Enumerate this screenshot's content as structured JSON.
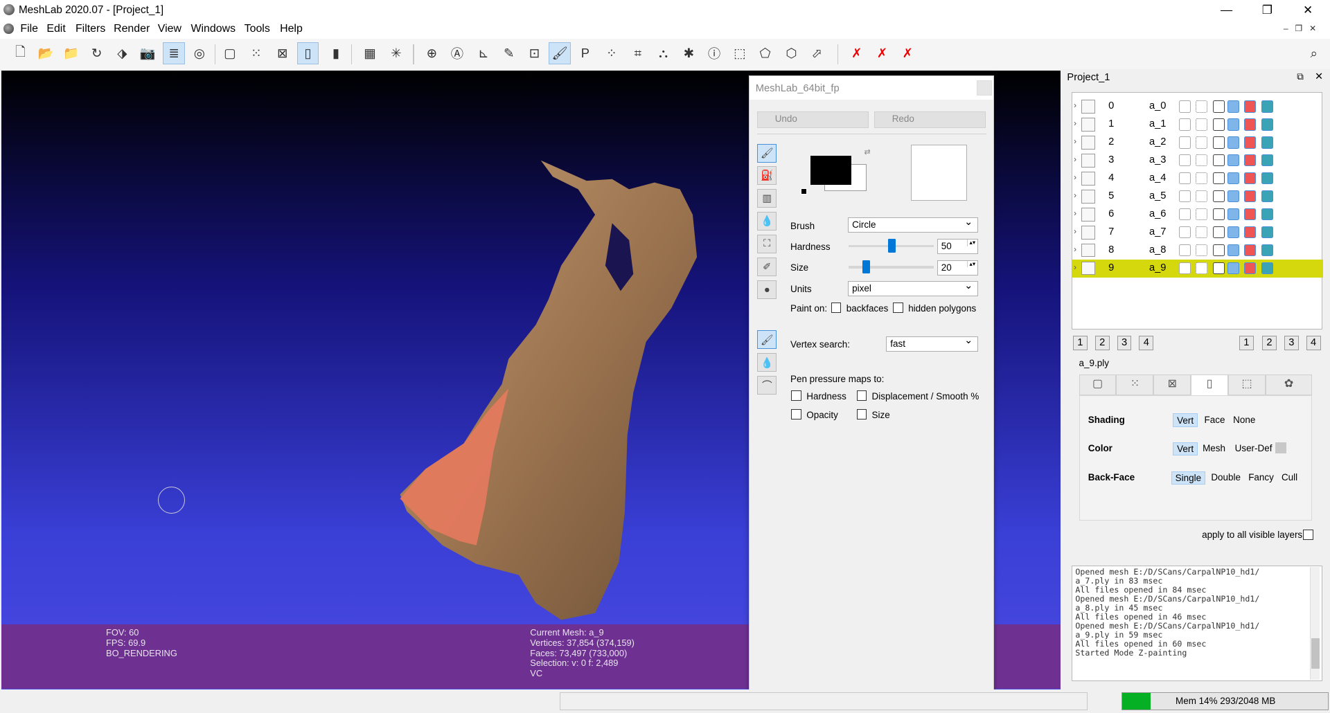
{
  "window": {
    "title": "MeshLab 2020.07 - [Project_1]",
    "minimize": "—",
    "maximize": "❐",
    "close": "✕"
  },
  "menu": [
    "File",
    "Edit",
    "Filters",
    "Render",
    "View",
    "Windows",
    "Tools",
    "Help"
  ],
  "viewport": {
    "fov": "FOV: 60",
    "fps": "FPS:    69.9",
    "mode": "BO_RENDERING",
    "current_mesh": "Current Mesh: a_9",
    "vertices": "Vertices: 37,854    (374,159)",
    "faces": "Faces: 73,497    (733,000)",
    "selection": "Selection: v: 0 f: 2,489",
    "vc": "VC"
  },
  "paint_dock": {
    "title": "MeshLab_64bit_fp",
    "undo": "Undo",
    "redo": "Redo",
    "brush_label": "Brush",
    "brush_value": "Circle",
    "hardness_label": "Hardness",
    "hardness_value": "50",
    "size_label": "Size",
    "size_value": "20",
    "units_label": "Units",
    "units_value": "pixel",
    "paint_on": "Paint on:",
    "backfaces": "backfaces",
    "hidden_polygons": "hidden polygons",
    "vertex_search_label": "Vertex search:",
    "vertex_search_value": "fast",
    "pen_pressure": "Pen pressure maps to:",
    "pp_hardness": "Hardness",
    "pp_displacement": "Displacement / Smooth %",
    "pp_opacity": "Opacity",
    "pp_size": "Size",
    "hardness_fraction": 0.5,
    "size_fraction": 0.2,
    "primary_color": "#000000",
    "secondary_color": "#ffffff"
  },
  "project": {
    "title": "Project_1",
    "layers": [
      {
        "idx": "0",
        "name": "a_0"
      },
      {
        "idx": "1",
        "name": "a_1"
      },
      {
        "idx": "2",
        "name": "a_2"
      },
      {
        "idx": "3",
        "name": "a_3"
      },
      {
        "idx": "4",
        "name": "a_4"
      },
      {
        "idx": "5",
        "name": "a_5"
      },
      {
        "idx": "6",
        "name": "a_6"
      },
      {
        "idx": "7",
        "name": "a_7"
      },
      {
        "idx": "8",
        "name": "a_8"
      },
      {
        "idx": "9",
        "name": "a_9"
      }
    ],
    "selected_layer": "9",
    "nums_left": [
      "1",
      "2",
      "3",
      "4"
    ],
    "nums_right": [
      "1",
      "2",
      "3",
      "4"
    ],
    "mesh_file": "a_9.ply",
    "shading_label": "Shading",
    "shading_opts": [
      "Vert",
      "Face",
      "None"
    ],
    "color_label": "Color",
    "color_opts": [
      "Vert",
      "Mesh",
      "User-Def"
    ],
    "backface_label": "Back-Face",
    "backface_opts": [
      "Single",
      "Double",
      "Fancy",
      "Cull"
    ],
    "apply_all": "apply to all visible layers"
  },
  "log": "Opened mesh E:/D/SCans/CarpalNP10_hd1/\na_7.ply in 83 msec\nAll files opened in 84 msec\nOpened mesh E:/D/SCans/CarpalNP10_hd1/\na_8.ply in 45 msec\nAll files opened in 46 msec\nOpened mesh E:/D/SCans/CarpalNP10_hd1/\na_9.ply in 59 msec\nAll files opened in 60 msec\nStarted Mode Z-painting",
  "status": {
    "mem": "Mem 14% 293/2048 MB",
    "mem_fraction": 0.14
  },
  "colors": {
    "selection_row": "#d5d80d",
    "info_bar": "#6e3192",
    "accent": "#0078d7"
  }
}
